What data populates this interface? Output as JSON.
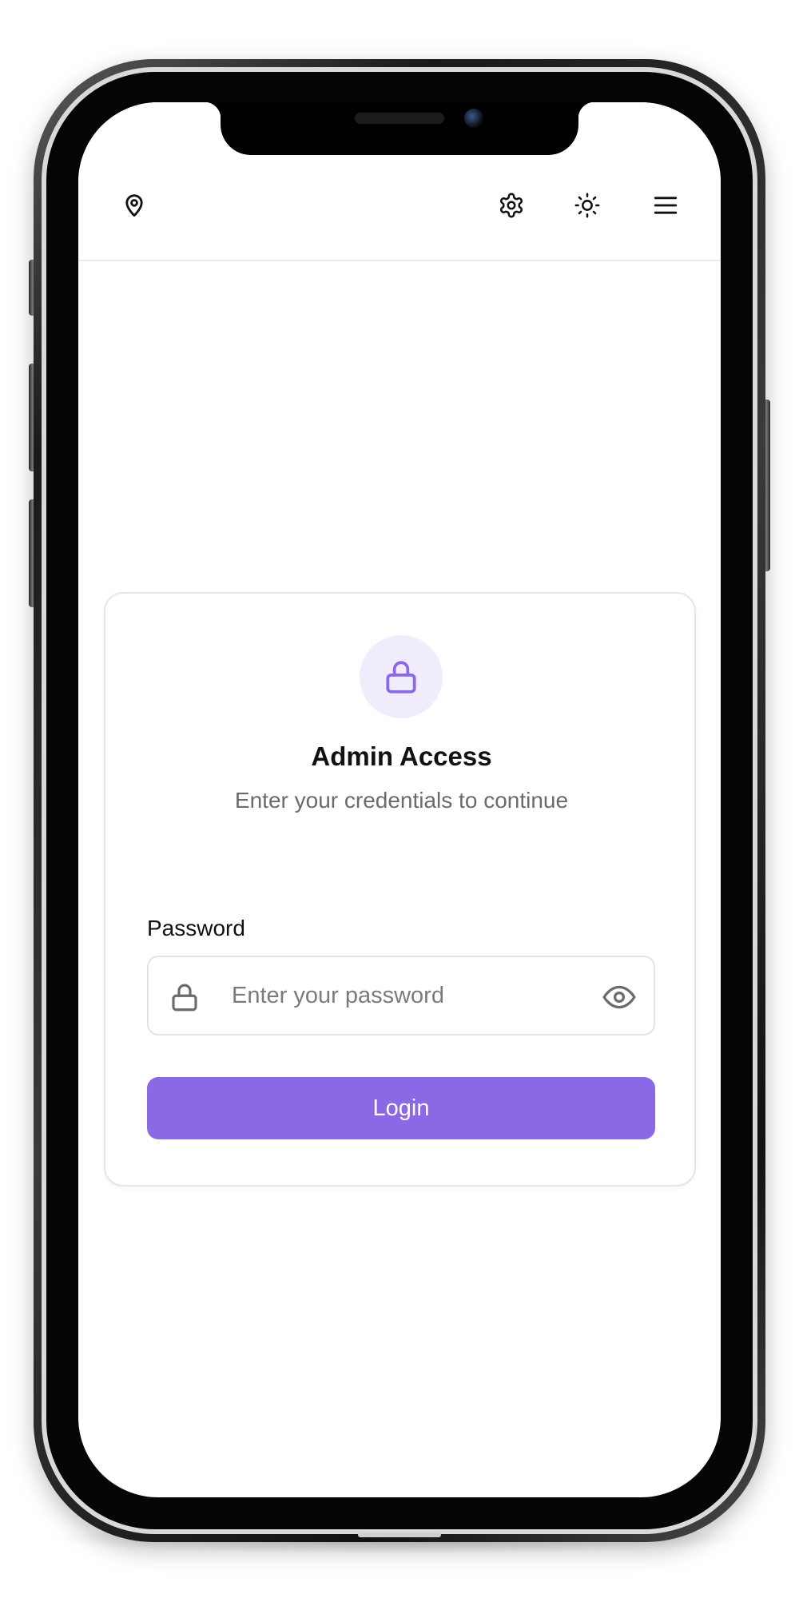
{
  "header": {
    "icons": [
      "map-pin-icon",
      "gear-icon",
      "sun-icon",
      "hamburger-menu-icon"
    ]
  },
  "login_card": {
    "icon": "lock-icon",
    "title": "Admin Access",
    "subtitle": "Enter your credentials to continue",
    "password_label": "Password",
    "password_value": "",
    "password_placeholder": "Enter your password",
    "visibility_icon": "eye-icon",
    "login_label": "Login"
  },
  "colors": {
    "accent": "#8b68e6",
    "accent_soft": "#f1ecfc",
    "text": "#111111",
    "muted_text": "#6b6b6b",
    "border": "#e4e4e4"
  }
}
